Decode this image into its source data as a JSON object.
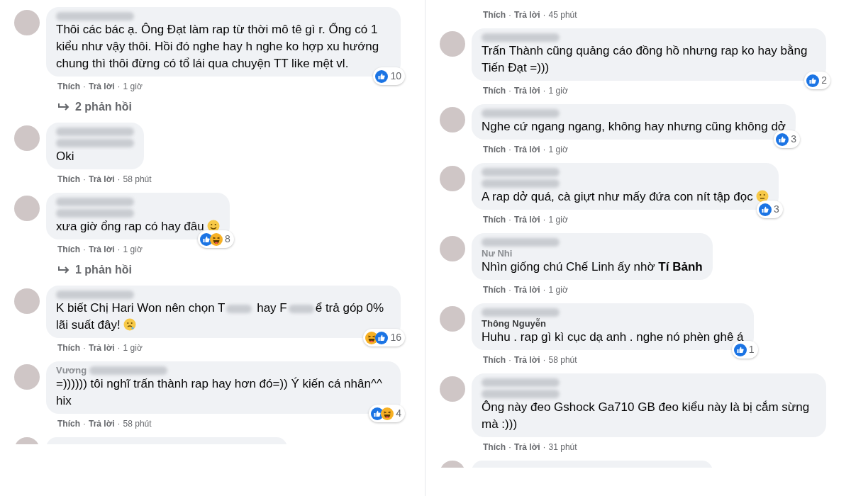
{
  "columns": [
    {
      "items": [
        {
          "kind": "comment",
          "header": [
            [
              {
                "kind": "blur"
              }
            ]
          ],
          "body": [
            {
              "kind": "text",
              "text": "Thôi các bác ạ. Ông Đạt làm rap từ thời mô tê gì r. Ổng có 1 kiểu như vậy thôi. Hồi đó nghe hay h nghe ko hợp xu hướng chung thì thôi đừng có tổ lái qua chuyện TT like mệt vl."
            }
          ],
          "reactions": [
            {
              "kind": "like"
            }
          ],
          "reaction_count": "10",
          "meta": {
            "like": "Thích",
            "sep": "·",
            "reply": "Trả lời",
            "time": "1 giờ"
          }
        },
        {
          "kind": "replies",
          "label": "2 phản hồi"
        },
        {
          "kind": "comment",
          "header": [
            [
              {
                "kind": "blur"
              }
            ],
            [
              {
                "kind": "blur"
              }
            ]
          ],
          "body": [
            {
              "kind": "text",
              "text": "Oki"
            }
          ],
          "meta": {
            "like": "Thích",
            "sep": "·",
            "reply": "Trả lời",
            "time": "58 phút"
          }
        },
        {
          "kind": "comment",
          "header": [
            [
              {
                "kind": "blur"
              }
            ],
            [
              {
                "kind": "blur"
              }
            ]
          ],
          "body": [
            {
              "kind": "text",
              "text": "xưa giờ ổng rap có hay đâu"
            },
            {
              "kind": "smile_emoji"
            }
          ],
          "reactions": [
            {
              "kind": "like"
            },
            {
              "kind": "haha"
            }
          ],
          "reaction_count": "8",
          "meta": {
            "like": "Thích",
            "sep": "·",
            "reply": "Trả lời",
            "time": "1 giờ"
          }
        },
        {
          "kind": "replies",
          "label": "1 phản hồi"
        },
        {
          "kind": "comment",
          "header": [
            [
              {
                "kind": "blur"
              }
            ]
          ],
          "body": [
            {
              "kind": "text",
              "text": "K biết Chị Hari Won nên chọn T"
            },
            {
              "kind": "blur"
            },
            {
              "kind": "text",
              "text": " hay F"
            },
            {
              "kind": "blur"
            },
            {
              "kind": "text",
              "text": "ể trả góp 0% lãi suất đây!"
            },
            {
              "kind": "drool_emoji"
            }
          ],
          "reactions": [
            {
              "kind": "haha"
            },
            {
              "kind": "like"
            }
          ],
          "reaction_count": "16",
          "meta": {
            "like": "Thích",
            "sep": "·",
            "reply": "Trả lời",
            "time": "1 giờ"
          }
        },
        {
          "kind": "comment",
          "header": [
            [
              {
                "kind": "text",
                "text": "Vương"
              },
              {
                "kind": "blur"
              }
            ]
          ],
          "body": [
            {
              "kind": "text",
              "text": "=)))))) tôi nghĩ trấn thành rap hay hơn đó=)) Ý kiến cá nhân^^ hix"
            }
          ],
          "reactions": [
            {
              "kind": "like"
            },
            {
              "kind": "haha"
            }
          ],
          "reaction_count": "4",
          "meta": {
            "like": "Thích",
            "sep": "·",
            "reply": "Trả lời",
            "time": "58 phút"
          }
        },
        {
          "kind": "cut"
        }
      ]
    },
    {
      "items": [
        {
          "kind": "meta",
          "meta": {
            "like": "Thích",
            "sep": "·",
            "reply": "Trả lời",
            "time": "45 phút"
          }
        },
        {
          "kind": "comment",
          "header": [
            [
              {
                "kind": "blur"
              }
            ]
          ],
          "body": [
            {
              "kind": "text",
              "text": "Trấn Thành cũng quảng cáo đồng hồ nhưng rap ko hay bằng Tiến Đạt =)))"
            }
          ],
          "reactions": [
            {
              "kind": "like"
            }
          ],
          "reaction_count": "2",
          "meta": {
            "like": "Thích",
            "sep": "·",
            "reply": "Trả lời",
            "time": "1 giờ"
          }
        },
        {
          "kind": "comment",
          "header": [
            [
              {
                "kind": "blur"
              }
            ]
          ],
          "body": [
            {
              "kind": "text",
              "text": "Nghe cứ ngang ngang, không hay nhưng cũng không dở"
            }
          ],
          "reactions": [
            {
              "kind": "like"
            }
          ],
          "reaction_count": "3",
          "meta": {
            "like": "Thích",
            "sep": "·",
            "reply": "Trả lời",
            "time": "1 giờ"
          }
        },
        {
          "kind": "comment",
          "header": [
            [
              {
                "kind": "blur"
              }
            ],
            [
              {
                "kind": "blur"
              }
            ]
          ],
          "body": [
            {
              "kind": "text",
              "text": "A rap dở quá, cà giựt như mấy đứa con nít tập đọc"
            },
            {
              "kind": "neutral_emoji"
            }
          ],
          "reactions": [
            {
              "kind": "like"
            }
          ],
          "reaction_count": "3",
          "meta": {
            "like": "Thích",
            "sep": "·",
            "reply": "Trả lời",
            "time": "1 giờ"
          }
        },
        {
          "kind": "comment",
          "header": [
            [
              {
                "kind": "blur"
              }
            ],
            [
              {
                "kind": "text",
                "text": "Nư Nhi"
              }
            ]
          ],
          "body": [
            {
              "kind": "text",
              "text": "Nhìn giống chú Chế Linh ấy nhờ **Tí Bảnh**"
            }
          ],
          "meta": {
            "like": "Thích",
            "sep": "·",
            "reply": "Trả lời",
            "time": "1 giờ"
          }
        },
        {
          "kind": "comment",
          "header": [
            [
              {
                "kind": "blur"
              }
            ],
            [
              {
                "kind": "name",
                "text": "Thông Nguyễn"
              }
            ]
          ],
          "body": [
            {
              "kind": "text",
              "text": "Huhu . rap gì kì cục dạ anh . nghe nó phèn ghê á"
            }
          ],
          "reactions": [
            {
              "kind": "like"
            }
          ],
          "reaction_count": "1",
          "meta": {
            "like": "Thích",
            "sep": "·",
            "reply": "Trả lời",
            "time": "58 phút"
          }
        },
        {
          "kind": "comment",
          "header": [
            [
              {
                "kind": "blur"
              }
            ],
            [
              {
                "kind": "blur"
              }
            ]
          ],
          "body": [
            {
              "kind": "text",
              "text": "Ông này đeo Gshock Ga710 GB đeo kiểu này là bị cắm sừng mà :)))"
            }
          ],
          "meta": {
            "like": "Thích",
            "sep": "·",
            "reply": "Trả lời",
            "time": "31 phút"
          }
        },
        {
          "kind": "cut"
        }
      ]
    }
  ]
}
